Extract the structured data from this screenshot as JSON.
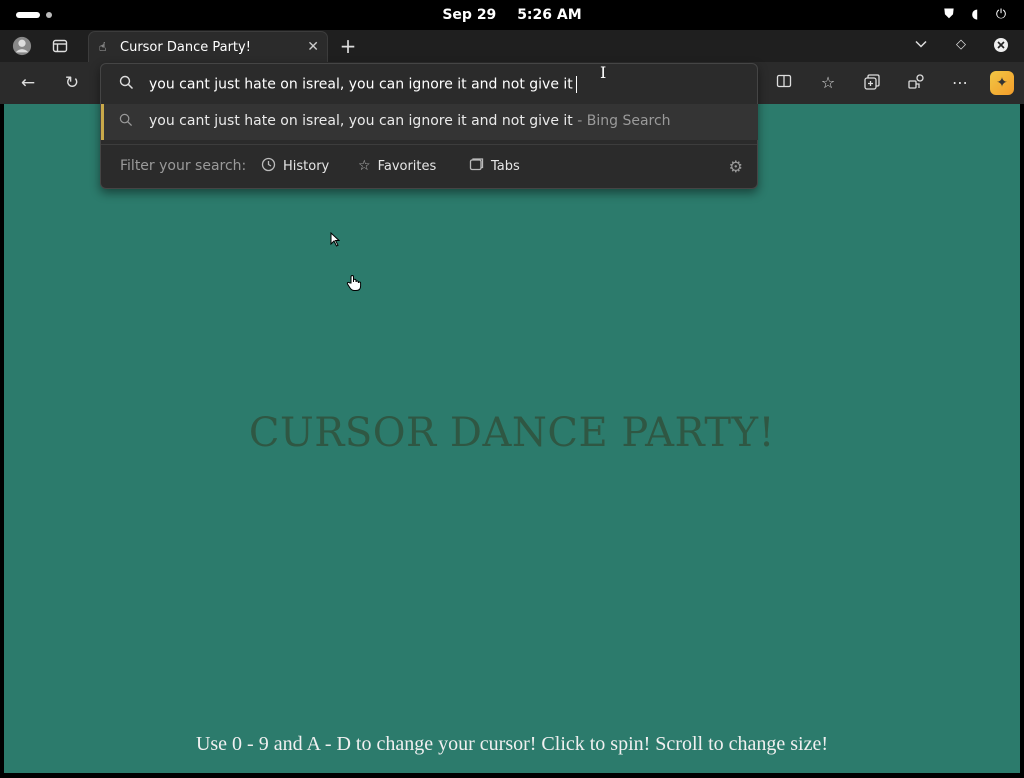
{
  "statusbar": {
    "date": "Sep 29",
    "time": "5:26 AM"
  },
  "tab": {
    "title": "Cursor Dance Party!"
  },
  "omnibox": {
    "query": "you cant just hate on isreal, you can ignore it and not give it",
    "suggestion_text": "you cant just hate on isreal, you can ignore it and not give it",
    "suggestion_source": " - Bing Search",
    "filter_label": "Filter your search:",
    "filters": [
      {
        "label": "History"
      },
      {
        "label": "Favorites"
      },
      {
        "label": "Tabs"
      }
    ]
  },
  "page": {
    "title": "CURSOR DANCE PARTY!",
    "footer": "Use 0 - 9 and A - D to change your cursor! Click to spin! Scroll to change size!",
    "background": "#2c7b6c"
  },
  "icons": {
    "profile": "profile-icon",
    "workspaces": "workspaces-icon",
    "back": "back-arrow-icon",
    "refresh": "refresh-icon",
    "split": "split-screen-icon",
    "favorites": "favorites-star-icon",
    "collections": "collections-icon",
    "extensions": "extensions-icon",
    "menu": "more-icon",
    "copilot": "copilot-icon"
  }
}
